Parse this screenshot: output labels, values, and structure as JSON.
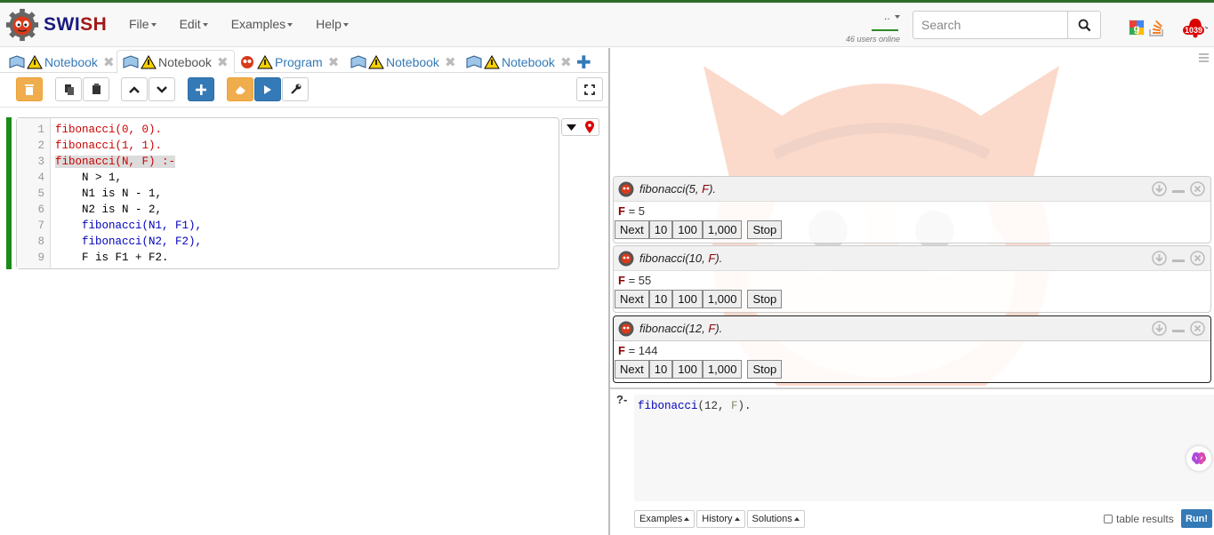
{
  "brand": {
    "name_prefix": "SWI",
    "name_suffix": "SH"
  },
  "menu": [
    "File",
    "Edit",
    "Examples",
    "Help"
  ],
  "users": {
    "dots": "..",
    "online": "46 users online"
  },
  "search": {
    "placeholder": "Search"
  },
  "notifications": {
    "badge": "1039"
  },
  "tabs": [
    {
      "label": "Notebook",
      "type": "notebook",
      "active": false
    },
    {
      "label": "Notebook",
      "type": "notebook",
      "active": true
    },
    {
      "label": "Program",
      "type": "program",
      "active": false
    },
    {
      "label": "Notebook",
      "type": "notebook",
      "active": false
    },
    {
      "label": "Notebook",
      "type": "notebook",
      "active": false
    }
  ],
  "code": {
    "line_numbers": [
      "1",
      "2",
      "3",
      "4",
      "5",
      "6",
      "7",
      "8",
      "9"
    ],
    "lines": [
      "fibonacci(0, 0).",
      "fibonacci(1, 1).",
      "fibonacci(N, F) :-",
      "    N > 1,",
      "    N1 is N - 1,",
      "    N2 is N - 2,",
      "    fibonacci(N1, F1),",
      "    fibonacci(N2, F2),",
      "    F is F1 + F2."
    ]
  },
  "answers": [
    {
      "pred": "fibonacci",
      "arg": "5",
      "var": "F",
      "binding_var": "F",
      "binding_value": "= 5"
    },
    {
      "pred": "fibonacci",
      "arg": "10",
      "var": "F",
      "binding_var": "F",
      "binding_value": "= 55"
    },
    {
      "pred": "fibonacci",
      "arg": "12",
      "var": "F",
      "binding_var": "F",
      "binding_value": "= 144"
    }
  ],
  "answer_buttons": {
    "next": "Next",
    "ten": "10",
    "hundred": "100",
    "thousand": "1,000",
    "stop": "Stop"
  },
  "query": {
    "prompt": "?-",
    "pred": "fibonacci",
    "args": "(12, ",
    "var": "F",
    "end": ")."
  },
  "query_buttons": {
    "examples": "Examples",
    "history": "History",
    "solutions": "Solutions",
    "table_results": "table results",
    "run": "Run!"
  },
  "colors": {
    "accent": "#337ab7",
    "orange": "#f0ad4e",
    "cell_green": "#1a8a1a",
    "var_red": "#8b0000"
  }
}
